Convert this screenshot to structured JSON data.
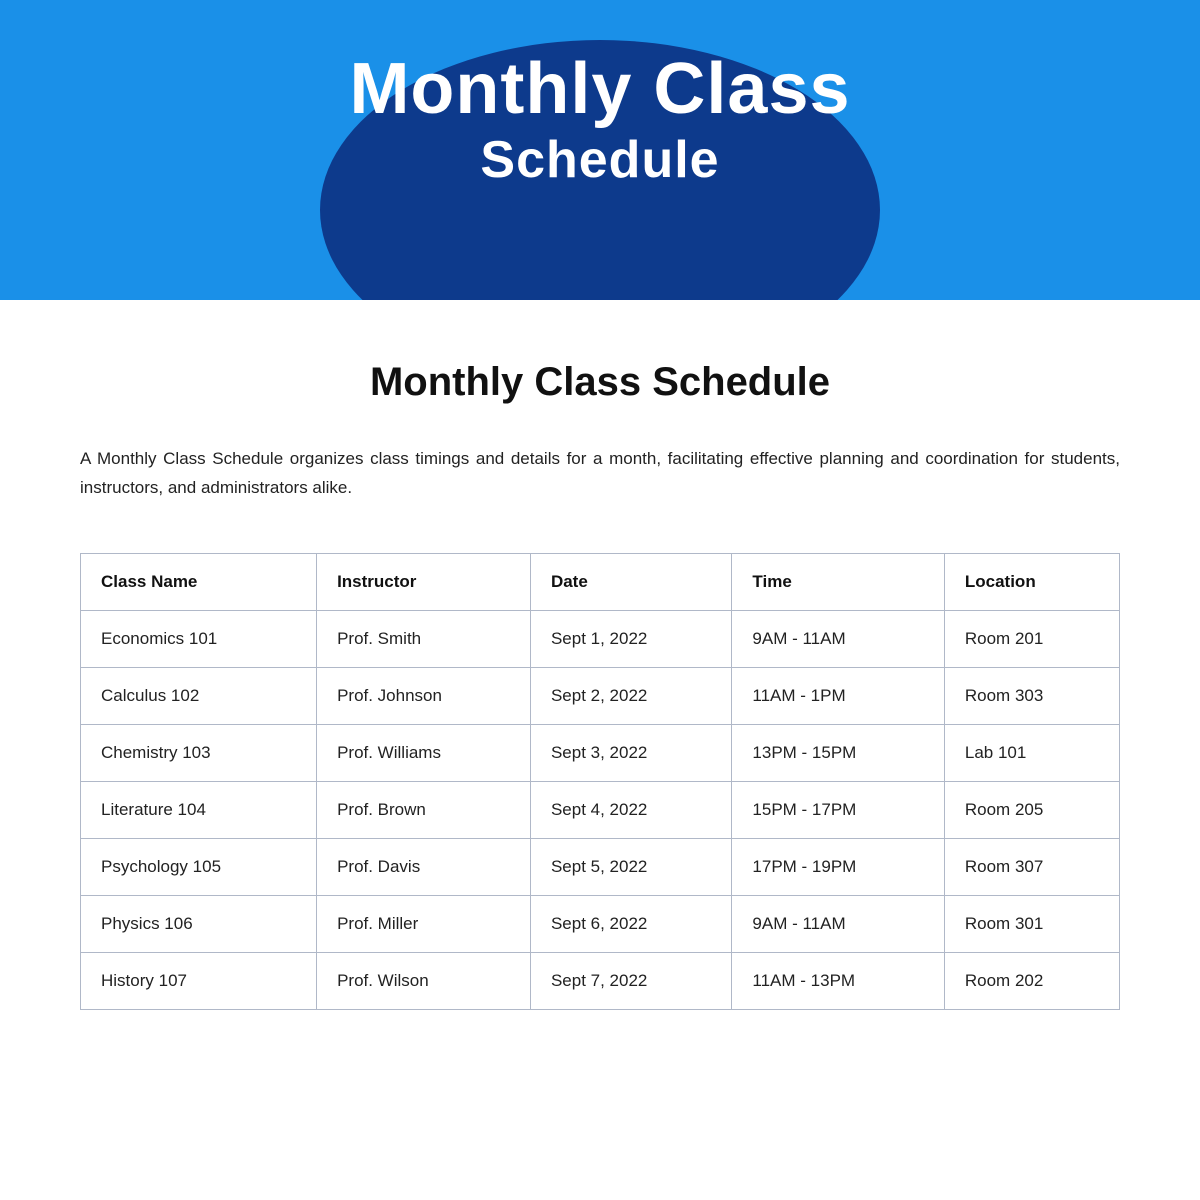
{
  "header": {
    "title_line1": "Monthly Class",
    "title_line2": "Schedule"
  },
  "main": {
    "page_heading": "Monthly Class Schedule",
    "description": "A Monthly Class Schedule organizes class timings and details for a month, facilitating effective planning and coordination for students, instructors, and administrators alike.",
    "table": {
      "columns": [
        "Class Name",
        "Instructor",
        "Date",
        "Time",
        "Location"
      ],
      "rows": [
        [
          "Economics 101",
          "Prof. Smith",
          "Sept 1, 2022",
          "9AM - 11AM",
          "Room 201"
        ],
        [
          "Calculus 102",
          "Prof. Johnson",
          "Sept 2, 2022",
          "11AM - 1PM",
          "Room 303"
        ],
        [
          "Chemistry 103",
          "Prof. Williams",
          "Sept 3, 2022",
          "13PM - 15PM",
          "Lab 101"
        ],
        [
          "Literature 104",
          "Prof. Brown",
          "Sept 4, 2022",
          "15PM - 17PM",
          "Room 205"
        ],
        [
          "Psychology 105",
          "Prof. Davis",
          "Sept 5, 2022",
          "17PM - 19PM",
          "Room 307"
        ],
        [
          "Physics 106",
          "Prof. Miller",
          "Sept 6, 2022",
          "9AM - 11AM",
          "Room 301"
        ],
        [
          "History 107",
          "Prof. Wilson",
          "Sept 7, 2022",
          "11AM - 13PM",
          "Room 202"
        ]
      ]
    }
  }
}
